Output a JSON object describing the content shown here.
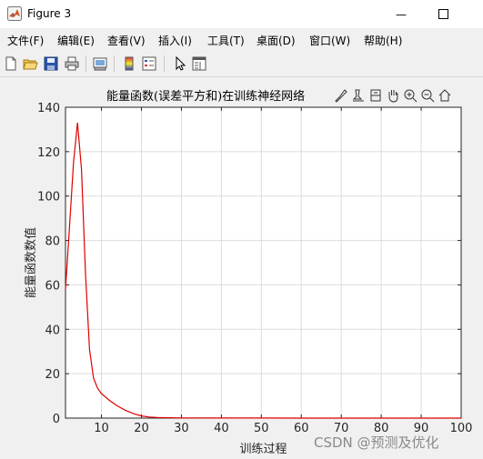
{
  "window": {
    "title": "Figure 3",
    "minimize_glyph": "—",
    "maximize_glyph": "☐"
  },
  "menu": {
    "items": [
      {
        "label": "文件(F)",
        "name": "menu-file"
      },
      {
        "label": "编辑(E)",
        "name": "menu-edit"
      },
      {
        "label": "查看(V)",
        "name": "menu-view"
      },
      {
        "label": "插入(I)",
        "name": "menu-insert"
      },
      {
        "label": "工具(T)",
        "name": "menu-tools"
      },
      {
        "label": "桌面(D)",
        "name": "menu-desktop"
      },
      {
        "label": "窗口(W)",
        "name": "menu-window"
      },
      {
        "label": "帮助(H)",
        "name": "menu-help"
      }
    ]
  },
  "toolbar": {
    "icons": [
      "new-figure-icon",
      "open-icon",
      "save-icon",
      "print-icon",
      "link-plot-icon",
      "colorbar-icon",
      "legend-icon",
      "pointer-icon",
      "property-editor-icon"
    ]
  },
  "axes_toolbar": {
    "icons": [
      "brush-icon",
      "data-tips-icon",
      "rotate-icon",
      "pan-icon",
      "zoom-in-icon",
      "zoom-out-icon",
      "home-icon"
    ]
  },
  "watermark": "CSDN @预测及优化",
  "chart_data": {
    "type": "line",
    "title": "能量函数(误差平方和)在训练神经网络过程中的变化",
    "title_visible": "能量函数(误差平方和)在训练神经网络",
    "xlabel": "训练过程",
    "ylabel": "能量函数数值",
    "xlim": [
      1,
      100
    ],
    "ylim": [
      0,
      140
    ],
    "xticks": [
      10,
      20,
      30,
      40,
      50,
      60,
      70,
      80,
      90,
      100
    ],
    "yticks": [
      0,
      20,
      40,
      60,
      80,
      100,
      120,
      140
    ],
    "grid": true,
    "series": [
      {
        "color": "#e00000",
        "x": [
          1,
          2,
          3,
          4,
          5,
          6,
          7,
          8,
          9,
          10,
          12,
          14,
          16,
          18,
          20,
          22,
          24,
          26,
          30,
          40,
          50,
          60,
          70,
          80,
          90,
          100
        ],
        "y": [
          58,
          86,
          115,
          133,
          112,
          65,
          31,
          18,
          13.5,
          11,
          8,
          5.5,
          3.5,
          2,
          1,
          0.5,
          0.3,
          0.2,
          0.1,
          0.05,
          0.03,
          0.02,
          0.02,
          0.02,
          0.02,
          0.02
        ]
      }
    ]
  }
}
